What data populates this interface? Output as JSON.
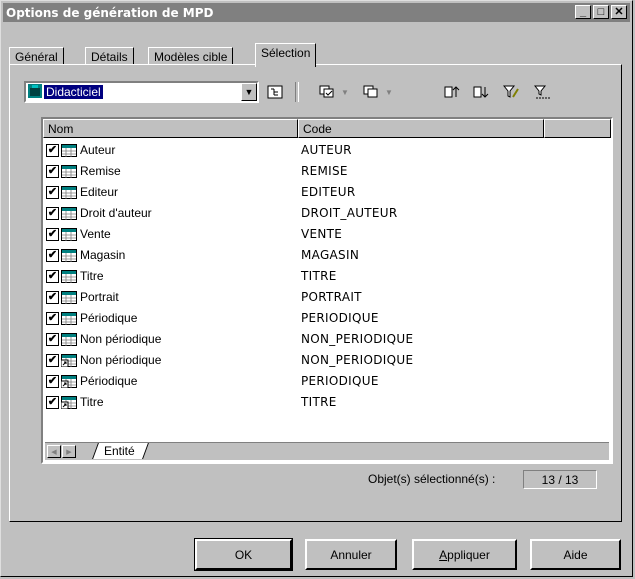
{
  "window": {
    "title": "Options de génération de MPD"
  },
  "titlebar_buttons": [
    "_",
    "□",
    "✕"
  ],
  "tabs": [
    {
      "label": "Général",
      "active": false
    },
    {
      "label": "Détails",
      "active": false
    },
    {
      "label": "Modèles cible",
      "active": false
    },
    {
      "label": "Sélection",
      "active": true
    }
  ],
  "package_select": {
    "value": "Didacticiel"
  },
  "toolbar_icons": [
    "package-tree-icon",
    "select-all-icon",
    "deselect-all-icon",
    "move-top-icon",
    "move-bottom-icon",
    "filter-icon",
    "clear-filter-icon"
  ],
  "list": {
    "columns": [
      "Nom",
      "Code"
    ],
    "rows": [
      {
        "nom": "Auteur",
        "code": "AUTEUR",
        "checked": true,
        "icon": "table-icon"
      },
      {
        "nom": "Remise",
        "code": "REMISE",
        "checked": true,
        "icon": "table-icon"
      },
      {
        "nom": "Editeur",
        "code": "EDITEUR",
        "checked": true,
        "icon": "table-icon"
      },
      {
        "nom": "Droit d'auteur",
        "code": "DROIT_AUTEUR",
        "checked": true,
        "icon": "table-icon"
      },
      {
        "nom": "Vente",
        "code": "VENTE",
        "checked": true,
        "icon": "table-icon"
      },
      {
        "nom": "Magasin",
        "code": "MAGASIN",
        "checked": true,
        "icon": "table-icon"
      },
      {
        "nom": "Titre",
        "code": "TITRE",
        "checked": true,
        "icon": "table-icon"
      },
      {
        "nom": "Portrait",
        "code": "PORTRAIT",
        "checked": true,
        "icon": "table-icon"
      },
      {
        "nom": "Périodique",
        "code": "PERIODIQUE",
        "checked": true,
        "icon": "table-icon"
      },
      {
        "nom": "Non périodique",
        "code": "NON_PERIODIQUE",
        "checked": true,
        "icon": "table-icon"
      },
      {
        "nom": "Non périodique",
        "code": "NON_PERIODIQUE",
        "checked": true,
        "icon": "shortcut-table-icon"
      },
      {
        "nom": "Périodique",
        "code": "PERIODIQUE",
        "checked": true,
        "icon": "shortcut-table-icon"
      },
      {
        "nom": "Titre",
        "code": "TITRE",
        "checked": true,
        "icon": "shortcut-table-icon"
      }
    ]
  },
  "sheet_tab": {
    "label": "Entité"
  },
  "status": {
    "label": "Objet(s) sélectionné(s) :",
    "value": "13 / 13"
  },
  "buttons": {
    "ok": "OK",
    "cancel": "Annuler",
    "apply_first": "A",
    "apply_rest": "ppliquer",
    "help": "Aide"
  }
}
